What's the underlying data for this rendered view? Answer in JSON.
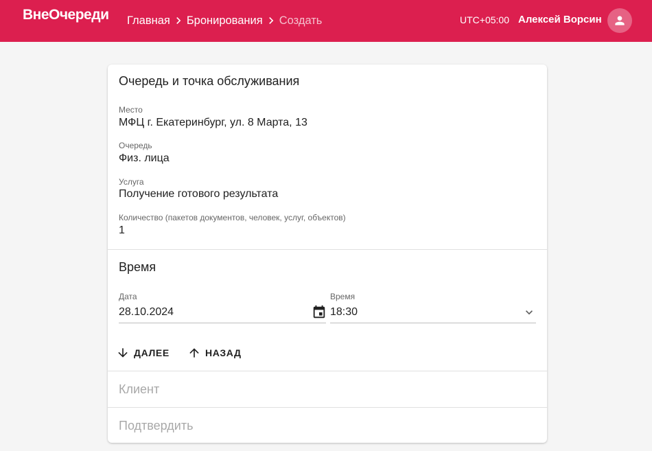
{
  "app": {
    "logo": "ВнеОчереди",
    "timezone": "UTC+05:00",
    "user_name": "Алексей Ворсин"
  },
  "breadcrumb": {
    "items": [
      "Главная",
      "Бронирования",
      "Создать"
    ]
  },
  "colors": {
    "primary": "#dc1f4f",
    "background": "#f5f5f5"
  },
  "queue_section": {
    "title": "Очередь и точка обслуживания",
    "fields": [
      {
        "label": "Место",
        "value": "МФЦ г. Екатеринбург, ул. 8 Марта, 13"
      },
      {
        "label": "Очередь",
        "value": "Физ. лица"
      },
      {
        "label": "Услуга",
        "value": "Получение готового результата"
      },
      {
        "label": "Количество (пакетов документов, человек, услуг, объектов)",
        "value": "1"
      }
    ]
  },
  "time_section": {
    "title": "Время",
    "date": {
      "label": "Дата",
      "value": "28.10.2024",
      "icon": "calendar-icon"
    },
    "time": {
      "label": "Время",
      "value": "18:30",
      "icon": "chevron-down-icon"
    },
    "next_label": "ДАЛЕЕ",
    "back_label": "НАЗАД"
  },
  "client_section": {
    "title": "Клиент"
  },
  "confirm_section": {
    "title": "Подтвердить"
  }
}
